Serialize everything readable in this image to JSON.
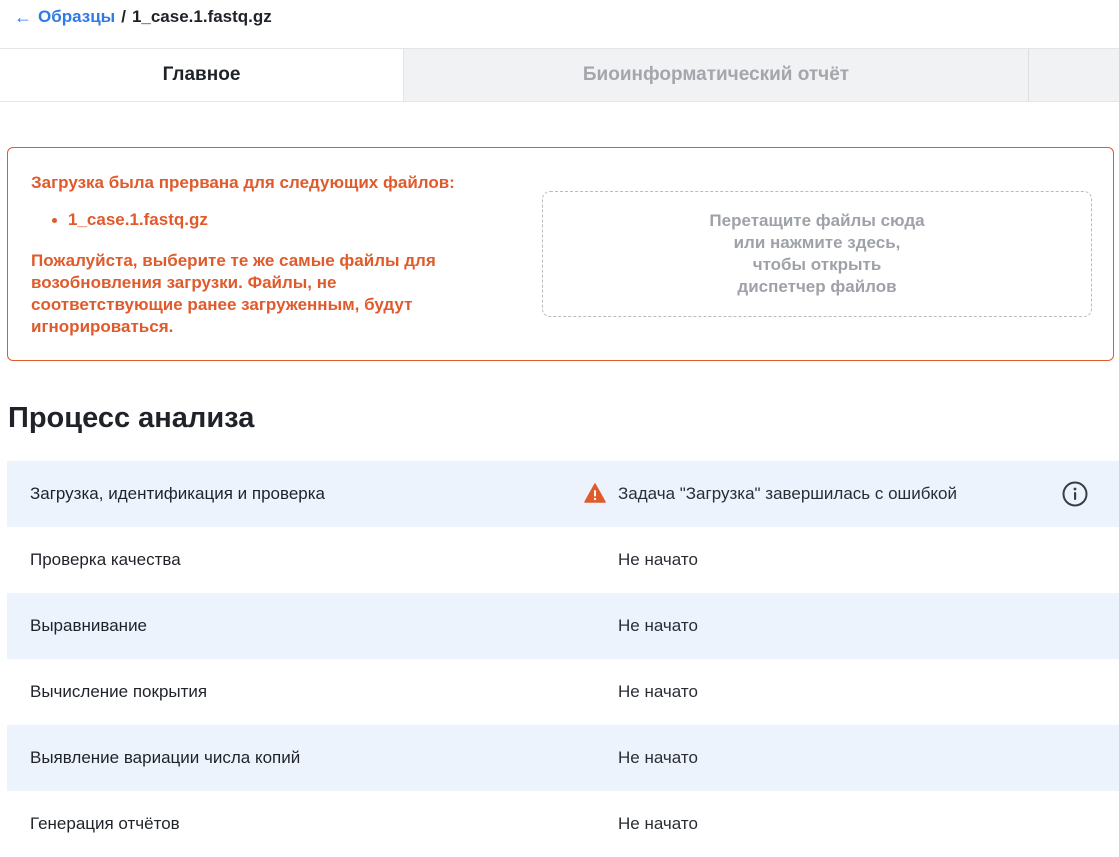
{
  "breadcrumb": {
    "back_icon": "arrow-left-icon",
    "parent_label": "Образцы",
    "separator": "/",
    "current_label": "1_case.1.fastq.gz"
  },
  "tabs": [
    {
      "label": "Главное",
      "active": true
    },
    {
      "label": "Биоинформатический отчёт",
      "active": false
    }
  ],
  "alert": {
    "color": "#e05a2c",
    "title": "Загрузка была прервана для следующих файлов:",
    "files": [
      "1_case.1.fastq.gz"
    ],
    "message": "Пожалуйста, выберите те же самые файлы для возобновления загрузки. Файлы, не соответствующие ранее загруженным, будут игнорироваться.",
    "dropzone_text": "Перетащите файлы сюда или нажмите здесь, чтобы открыть диспетчер файлов"
  },
  "analysis": {
    "title": "Процесс анализа",
    "steps": [
      {
        "name": "Загрузка, идентификация и проверка",
        "status": "Задача \"Загрузка\" завершилась с ошибкой",
        "status_icon": "warning-icon",
        "action_icon": "info-icon"
      },
      {
        "name": "Проверка качества",
        "status": "Не начато"
      },
      {
        "name": "Выравнивание",
        "status": "Не начато"
      },
      {
        "name": "Вычисление покрытия",
        "status": "Не начато"
      },
      {
        "name": "Выявление вариации числа копий",
        "status": "Не начато"
      },
      {
        "name": "Генерация отчётов",
        "status": "Не начато"
      }
    ]
  },
  "colors": {
    "accent": "#2f7ae5",
    "error": "#e05a2c",
    "row_shade": "#edf3fc"
  }
}
